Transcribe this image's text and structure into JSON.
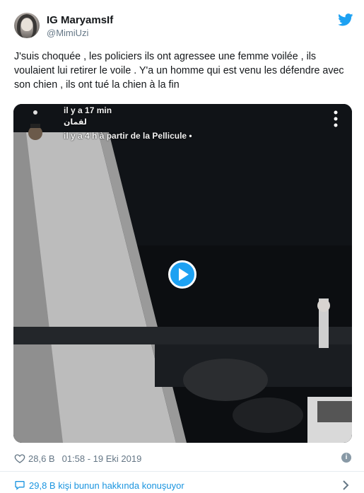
{
  "author": {
    "display_name": "IG MaryamsIf",
    "handle": "@MimiUzi"
  },
  "tweet": {
    "text": "J'suis choquée , les policiers ils ont agressee une femme voilée , ils voulaient lui retirer le voile . Y'a un homme qui est venu les défendre avec son chien , ils ont tué la chien à la fin"
  },
  "media": {
    "overlay_line1": "il y a 17 min",
    "overlay_line2": "لقمان",
    "overlay_line3": "il y a 4 h à partir de la Pellicule •"
  },
  "meta": {
    "like_count": "28,6 B",
    "timestamp": "01:58 - 19 Eki 2019"
  },
  "footer": {
    "conversation_text": "29,8 B kişi bunun hakkında konuşuyor"
  },
  "colors": {
    "accent": "#1da1f2",
    "link": "#1b95e0",
    "secondary_text": "#657786"
  },
  "icons": [
    "twitter-bird-icon",
    "play-icon",
    "heart-icon",
    "info-icon",
    "speech-bubble-icon",
    "chevron-right-icon",
    "more-vertical-icon"
  ]
}
